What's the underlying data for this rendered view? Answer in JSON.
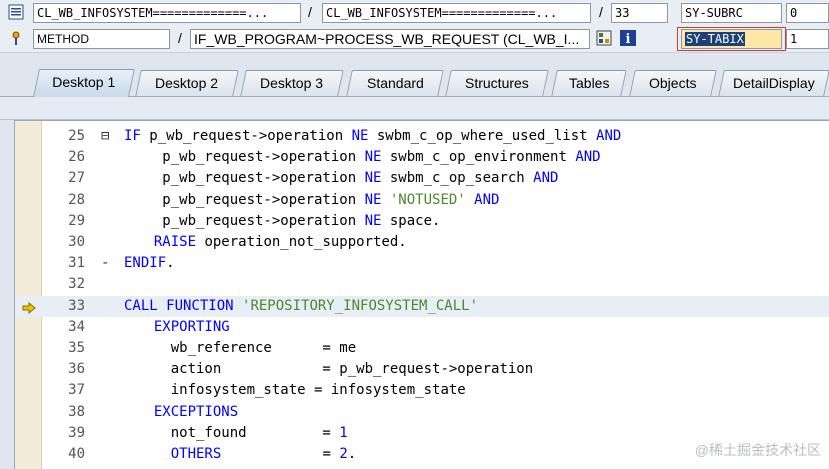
{
  "header": {
    "row1": {
      "program_field": "CL_WB_INFOSYSTEM=============...",
      "include_field": "CL_WB_INFOSYSTEM=============...",
      "separator": "/",
      "line_number": "33",
      "sysvar1_name": "SY-SUBRC",
      "sysvar1_value": "0"
    },
    "row2": {
      "event_type": "METHOD",
      "separator": "/",
      "event_name": "IF_WB_PROGRAM~PROCESS_WB_REQUEST (CL_WB_I...",
      "sysvar2_name": "SY-TABIX",
      "sysvar2_value": "1"
    }
  },
  "tabs": [
    {
      "label": "Desktop 1"
    },
    {
      "label": "Desktop 2"
    },
    {
      "label": "Desktop 3"
    },
    {
      "label": "Standard"
    },
    {
      "label": "Structures"
    },
    {
      "label": "Tables"
    },
    {
      "label": "Objects"
    },
    {
      "label": "DetailDisplay"
    }
  ],
  "editor": {
    "current_line": "33",
    "lines": [
      {
        "num": "25",
        "fold": "⊟",
        "indent": 0,
        "tokens": [
          [
            "kw",
            "IF"
          ],
          [
            "t",
            " p_wb_request->operation "
          ],
          [
            "kw",
            "NE"
          ],
          [
            "t",
            " swbm_c_op_where_used_list "
          ],
          [
            "kw",
            "AND"
          ]
        ]
      },
      {
        "num": "26",
        "fold": "",
        "indent": 3,
        "tokens": [
          [
            "t",
            "p_wb_request->operation "
          ],
          [
            "kw",
            "NE"
          ],
          [
            "t",
            " swbm_c_op_environment "
          ],
          [
            "kw",
            "AND"
          ]
        ]
      },
      {
        "num": "27",
        "fold": "",
        "indent": 3,
        "tokens": [
          [
            "t",
            "p_wb_request->operation "
          ],
          [
            "kw",
            "NE"
          ],
          [
            "t",
            " swbm_c_op_search "
          ],
          [
            "kw",
            "AND"
          ]
        ]
      },
      {
        "num": "28",
        "fold": "",
        "indent": 3,
        "tokens": [
          [
            "t",
            "p_wb_request->operation "
          ],
          [
            "kw",
            "NE"
          ],
          [
            "t",
            " "
          ],
          [
            "str",
            "'NOTUSED'"
          ],
          [
            "t",
            " "
          ],
          [
            "kw",
            "AND"
          ]
        ]
      },
      {
        "num": "29",
        "fold": "",
        "indent": 3,
        "tokens": [
          [
            "t",
            "p_wb_request->operation "
          ],
          [
            "kw",
            "NE"
          ],
          [
            "t",
            " space."
          ]
        ]
      },
      {
        "num": "30",
        "fold": "",
        "indent": 2,
        "tokens": [
          [
            "kw",
            "RAISE"
          ],
          [
            "t",
            " operation_not_supported."
          ]
        ]
      },
      {
        "num": "31",
        "fold": "-",
        "indent": 0,
        "tokens": [
          [
            "kw",
            "ENDIF"
          ],
          [
            "t",
            "."
          ]
        ]
      },
      {
        "num": "32",
        "fold": "",
        "indent": 0,
        "tokens": []
      },
      {
        "num": "33",
        "fold": "",
        "indent": 0,
        "cur": true,
        "tokens": [
          [
            "kw",
            "CALL FUNCTION"
          ],
          [
            "t",
            " "
          ],
          [
            "str",
            "'REPOSITORY_INFOSYSTEM_CALL'"
          ]
        ]
      },
      {
        "num": "34",
        "fold": "",
        "indent": 2,
        "tokens": [
          [
            "kw",
            "EXPORTING"
          ]
        ]
      },
      {
        "num": "35",
        "fold": "",
        "indent": 4,
        "tokens": [
          [
            "t",
            "wb_reference      = me"
          ]
        ]
      },
      {
        "num": "36",
        "fold": "",
        "indent": 4,
        "tokens": [
          [
            "t",
            "action            = p_wb_request->operation"
          ]
        ]
      },
      {
        "num": "37",
        "fold": "",
        "indent": 4,
        "tokens": [
          [
            "t",
            "infosystem_state = infosystem_state"
          ]
        ]
      },
      {
        "num": "38",
        "fold": "",
        "indent": 2,
        "tokens": [
          [
            "kw",
            "EXCEPTIONS"
          ]
        ]
      },
      {
        "num": "39",
        "fold": "",
        "indent": 4,
        "tokens": [
          [
            "t",
            "not_found         = "
          ],
          [
            "num",
            "1"
          ]
        ]
      },
      {
        "num": "40",
        "fold": "",
        "indent": 4,
        "tokens": [
          [
            "kw",
            "OTHERS"
          ],
          [
            "t",
            "            = "
          ],
          [
            "num",
            "2"
          ],
          [
            "t",
            "."
          ]
        ]
      }
    ]
  },
  "watermark": "@稀土掘金技术社区",
  "colors": {
    "keyword": "#0000ff",
    "string": "#4a8a2a",
    "current_line_bg": "#e7eef6",
    "gutter_bg": "#f2ecd8",
    "highlight_field_bg": "#1d3f7a"
  },
  "icons": {
    "row1_left": "list-icon",
    "row2_left": "method-icon",
    "row2_mid": "structure-icon",
    "row2_info": "info-icon",
    "breakpoint_arrow": "arrow-right-icon"
  }
}
